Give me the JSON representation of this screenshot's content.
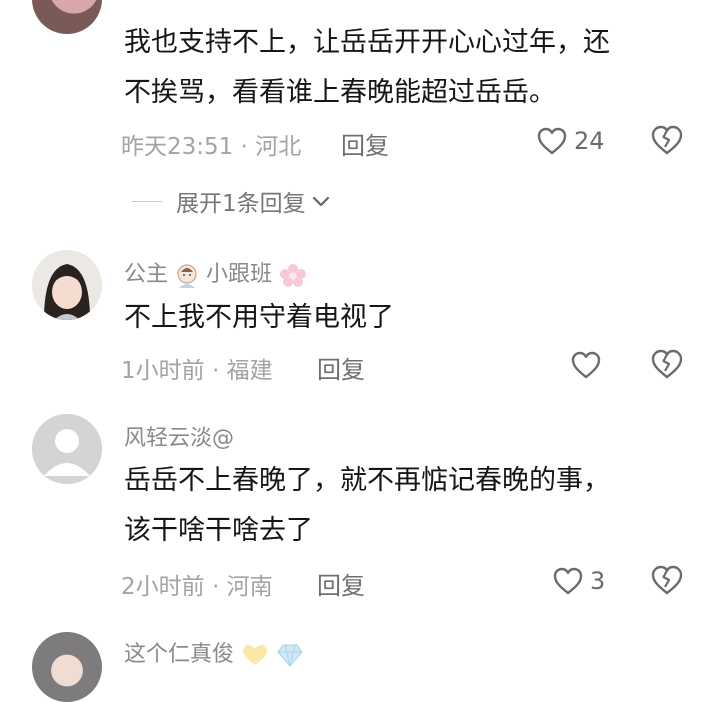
{
  "comments": [
    {
      "name": "",
      "text_lines": [
        "我也支持不上，让岳岳开开心心过年，还",
        "不挨骂，看看谁上春晚能超过岳岳。"
      ],
      "time": "昨天23:51",
      "location": "河北",
      "reply_label": "回复",
      "likes": "24",
      "expand_label": "展开1条回复"
    },
    {
      "name": "公主",
      "name_suffix": "小跟班",
      "text_lines": [
        "不上我不用守着电视了"
      ],
      "time": "1小时前",
      "location": "福建",
      "reply_label": "回复",
      "likes": ""
    },
    {
      "name": "风轻云淡@",
      "text_lines": [
        "岳岳不上春晚了，就不再惦记春晚的事，",
        "该干啥干啥去了"
      ],
      "time": "2小时前",
      "location": "河南",
      "reply_label": "回复",
      "likes": "3"
    },
    {
      "name": "这个仁真俊",
      "text_lines": [],
      "time": "",
      "location": "",
      "reply_label": "",
      "likes": ""
    }
  ],
  "meta_separator": " · ",
  "icons": {
    "like": "heart-outline-icon",
    "dislike": "broken-heart-icon",
    "expand": "chevron-down-icon",
    "default_avatar": "default-avatar-icon"
  },
  "colors": {
    "text": "#161616",
    "muted": "#a3a3a3",
    "icon": "#6b6b6b",
    "background": "#ffffff"
  }
}
